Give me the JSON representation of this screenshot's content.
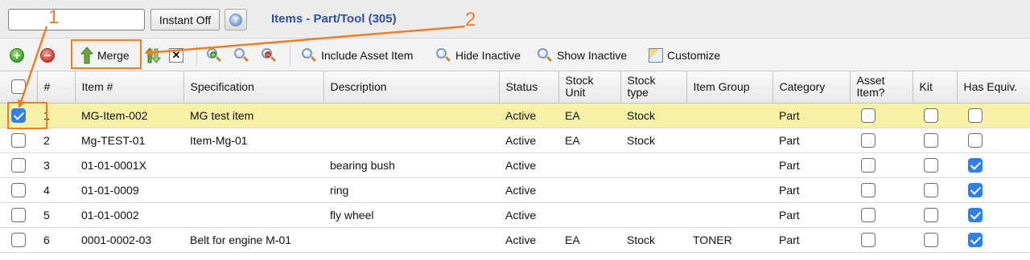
{
  "header": {
    "search_value": "",
    "instant_label": "Instant Off",
    "help_icon": "help-icon",
    "title": "Items - Part/Tool (305)"
  },
  "toolbar": {
    "add_icon": "plus-circle-icon",
    "delete_icon": "minus-circle-icon",
    "merge_label": "Merge",
    "include_asset_label": "Include Asset Item",
    "hide_inactive_label": "Hide Inactive",
    "show_inactive_label": "Show Inactive",
    "customize_label": "Customize"
  },
  "table": {
    "columns": [
      "",
      "#",
      "Item #",
      "Specification",
      "Description",
      "Status",
      "Stock Unit",
      "Stock type",
      "Item Group",
      "Category",
      "Asset Item?",
      "Kit",
      "Has Equiv."
    ],
    "rows": [
      {
        "checked": true,
        "num": "1",
        "item": "MG-Item-002",
        "spec": "MG test item",
        "desc": "",
        "status": "Active",
        "unit": "EA",
        "type": "Stock",
        "group": "",
        "category": "Part",
        "asset": false,
        "kit": false,
        "equiv": false
      },
      {
        "checked": false,
        "num": "2",
        "item": "Mg-TEST-01",
        "spec": "Item-Mg-01",
        "desc": "",
        "status": "Active",
        "unit": "EA",
        "type": "Stock",
        "group": "",
        "category": "Part",
        "asset": false,
        "kit": false,
        "equiv": false
      },
      {
        "checked": false,
        "num": "3",
        "item": "01-01-0001X",
        "spec": "",
        "desc": "bearing bush",
        "status": "Active",
        "unit": "",
        "type": "",
        "group": "",
        "category": "Part",
        "asset": false,
        "kit": false,
        "equiv": true
      },
      {
        "checked": false,
        "num": "4",
        "item": "01-01-0009",
        "spec": "",
        "desc": "ring",
        "status": "Active",
        "unit": "",
        "type": "",
        "group": "",
        "category": "Part",
        "asset": false,
        "kit": false,
        "equiv": true
      },
      {
        "checked": false,
        "num": "5",
        "item": "01-01-0002",
        "spec": "",
        "desc": "fly wheel",
        "status": "Active",
        "unit": "",
        "type": "",
        "group": "",
        "category": "Part",
        "asset": false,
        "kit": false,
        "equiv": true
      },
      {
        "checked": false,
        "num": "6",
        "item": "0001-0002-03",
        "spec": "Belt for engine M-01",
        "desc": "",
        "status": "Active",
        "unit": "EA",
        "type": "Stock",
        "group": "TONER",
        "category": "Part",
        "asset": false,
        "kit": false,
        "equiv": true
      }
    ]
  },
  "annotations": {
    "label_1": "1",
    "label_2": "2",
    "color": "#ef7d22"
  },
  "colors": {
    "title": "#2d4fa6",
    "selected_row": "#f8f1a8",
    "checkbox_checked": "#2f7ff0"
  }
}
